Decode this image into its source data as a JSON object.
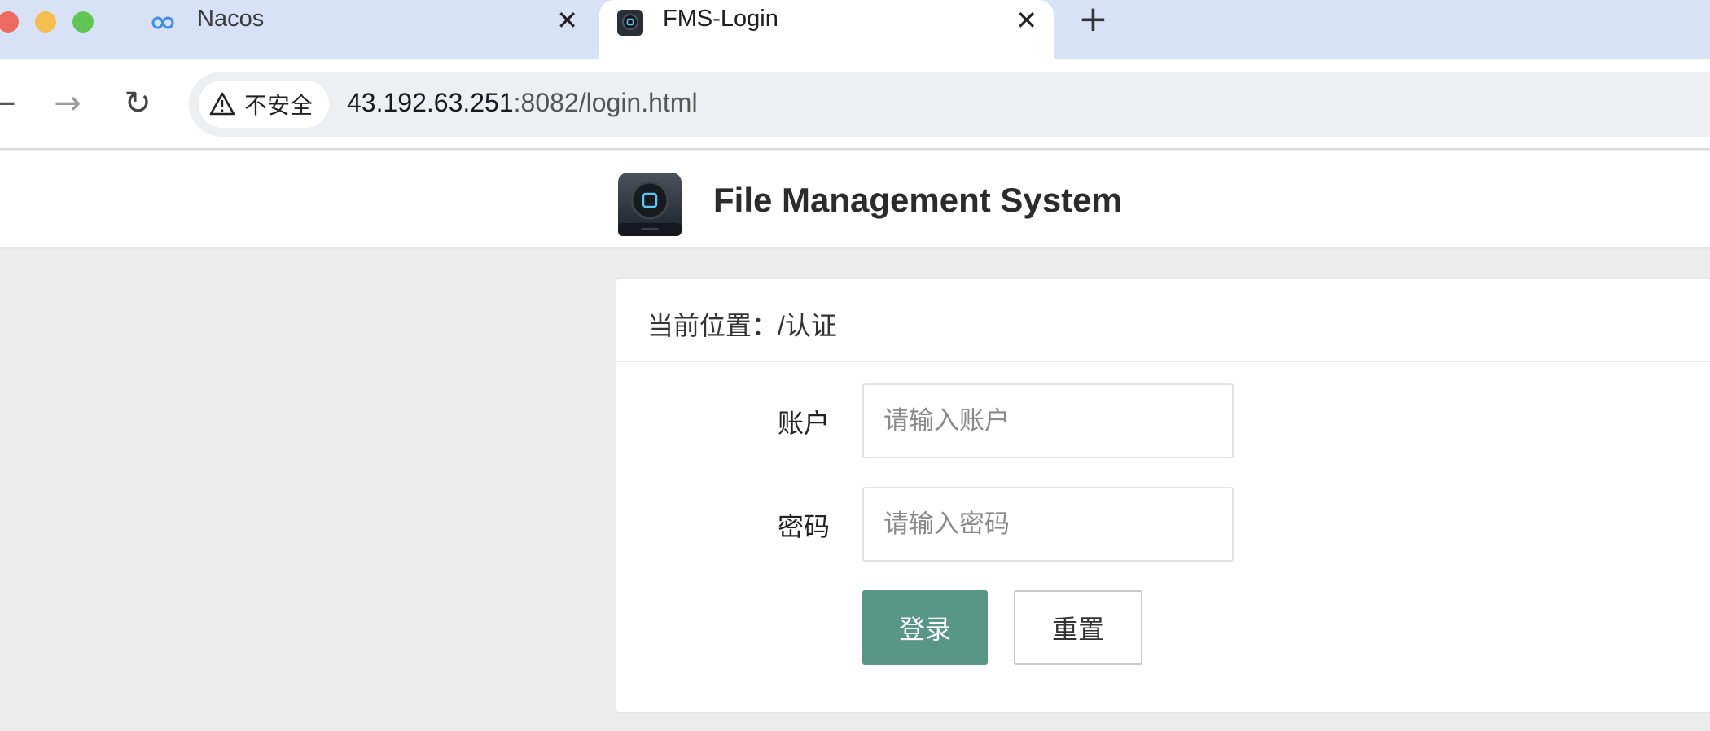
{
  "browser": {
    "tabs": [
      {
        "title": "Nacos",
        "icon": "nacos-infinity-icon",
        "active": false
      },
      {
        "title": "FMS-Login",
        "icon": "fms-app-icon",
        "active": true
      }
    ],
    "close_glyph": "✕",
    "new_tab_glyph": "+",
    "nav": {
      "back": "←",
      "forward": "→",
      "reload": "↻"
    },
    "security_label": "不安全",
    "url_host": "43.192.63.251",
    "url_rest": ":8082/login.html"
  },
  "header": {
    "title": "File Management System",
    "logo": "fms-logo-icon"
  },
  "card": {
    "breadcrumb": "当前位置：/认证",
    "account_label": "账户",
    "account_placeholder": "请输入账户",
    "account_value": "",
    "password_label": "密码",
    "password_placeholder": "请输入密码",
    "password_value": "",
    "login_label": "登录",
    "reset_label": "重置"
  },
  "colors": {
    "tabstrip": "#d7e2f7",
    "primary_button": "#589686",
    "page_background": "#ececec"
  }
}
